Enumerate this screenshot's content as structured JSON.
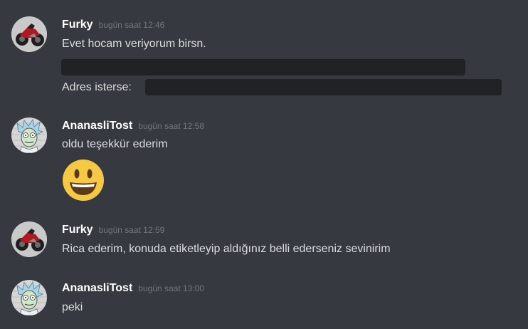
{
  "messages": [
    {
      "author": "Furky",
      "timestamp": "bugün saat 12:46",
      "avatar_icon": "motorcycle-avatar-icon",
      "lines": [
        "Evet hocam veriyorum birsn.",
        "Adres isterse:"
      ]
    },
    {
      "author": "AnanasliTost",
      "timestamp": "bugün saat 12:58",
      "avatar_icon": "rick-cartoon-avatar-icon",
      "lines": [
        "oldu teşekkür ederim"
      ],
      "emoji": "grinning-face-emoji"
    },
    {
      "author": "Furky",
      "timestamp": "bugün saat 12:59",
      "avatar_icon": "motorcycle-avatar-icon",
      "lines": [
        "Rica ederim, konuda etiketleyip aldığınız belli ederseniz sevinirim"
      ]
    },
    {
      "author": "AnanasliTost",
      "timestamp": "bugün saat 13:00",
      "avatar_icon": "rick-cartoon-avatar-icon",
      "lines": [
        "peki"
      ]
    }
  ],
  "colors": {
    "background": "#36393f",
    "username": "#ffffff",
    "message_text": "#dcddde",
    "timestamp": "#72767d",
    "spoiler": "#202225",
    "emoji": "#f6c945"
  }
}
